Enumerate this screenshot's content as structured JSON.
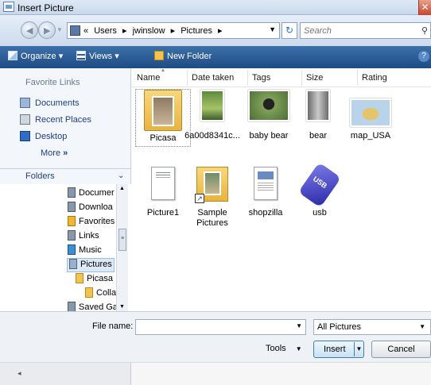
{
  "window": {
    "title": "Insert Picture",
    "close_glyph": "✕"
  },
  "address": {
    "crumb_prefix": "«",
    "crumbs": [
      "Users",
      "jwinslow",
      "Pictures"
    ],
    "separator": "▸",
    "refresh_glyph": "↻",
    "search_placeholder": "Search"
  },
  "toolbar": {
    "organize": "Organize",
    "views": "Views",
    "new_folder": "New Folder",
    "dropdown_glyph": "▾",
    "help_glyph": "?"
  },
  "nav": {
    "favorite_heading": "Favorite Links",
    "links": [
      "Documents",
      "Recent Places",
      "Desktop"
    ],
    "more": "More",
    "more_glyph": "»",
    "folders_label": "Folders",
    "folders_chevron": "⌄",
    "tree": [
      {
        "label": "Documer",
        "icon": "doc"
      },
      {
        "label": "Downloa",
        "icon": "doc"
      },
      {
        "label": "Favorites",
        "icon": "fav"
      },
      {
        "label": "Links",
        "icon": "doc"
      },
      {
        "label": "Music",
        "icon": "music"
      },
      {
        "label": "Pictures",
        "icon": "pic",
        "selected": true
      },
      {
        "label": "Picasa",
        "icon": "yellow"
      },
      {
        "label": "Colla",
        "icon": "yellow"
      },
      {
        "label": "Saved Ga",
        "icon": "doc"
      }
    ]
  },
  "columns": [
    "Name",
    "Date taken",
    "Tags",
    "Size",
    "Rating"
  ],
  "files": [
    {
      "name": "Picasa",
      "kind": "folder"
    },
    {
      "name": "6a00d8341c...",
      "kind": "photo1"
    },
    {
      "name": "baby bear",
      "kind": "photo2"
    },
    {
      "name": "bear",
      "kind": "photo3"
    },
    {
      "name": "map_USA",
      "kind": "map"
    },
    {
      "name": "Picture1",
      "kind": "doc"
    },
    {
      "name": "Sample Pictures",
      "kind": "folder2"
    },
    {
      "name": "shopzilla",
      "kind": "page"
    },
    {
      "name": "usb",
      "kind": "usb"
    }
  ],
  "bottom": {
    "file_name_label": "File name:",
    "file_name_value": "",
    "filter_value": "All Pictures",
    "tools_label": "Tools",
    "insert_label": "Insert",
    "cancel_label": "Cancel"
  },
  "colors": {
    "toolbar_top": "#3d6fa9",
    "toolbar_bottom": "#1e4c84",
    "link": "#1f3f87",
    "selection": "#dce9f7"
  }
}
